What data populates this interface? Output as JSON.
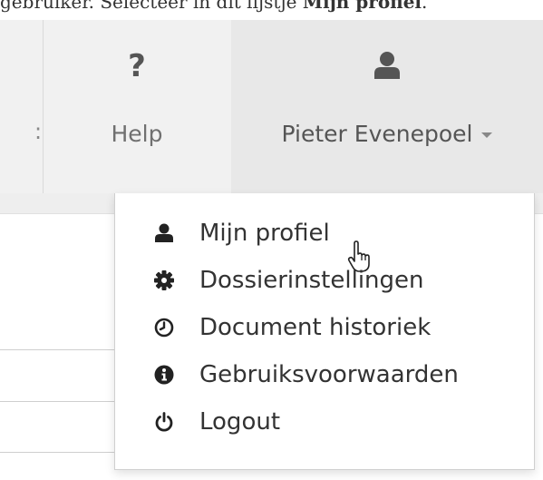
{
  "caption": {
    "text_before": "gebruiker. Selecteer in dit lijstje ",
    "bold": "Mijn profiel",
    "text_after": "."
  },
  "navbar": {
    "left_fragment": ":",
    "help": {
      "icon": "question-icon",
      "glyph": "?",
      "label": "Help"
    },
    "user": {
      "icon": "user-icon",
      "label": "Pieter Evenepoel"
    }
  },
  "dropdown": {
    "items": [
      {
        "label": "Mijn profiel",
        "icon": "user-icon"
      },
      {
        "label": "Dossierinstellingen",
        "icon": "cog-icon"
      },
      {
        "label": "Document historiek",
        "icon": "clock-icon"
      },
      {
        "label": "Gebruiksvoorwaarden",
        "icon": "info-icon"
      },
      {
        "label": "Logout",
        "icon": "power-icon"
      }
    ]
  },
  "colors": {
    "navbar_bg": "#f1f1f1",
    "active_nav_bg": "#e8e8e8",
    "icon": "#555555",
    "menu_text": "#333333"
  }
}
